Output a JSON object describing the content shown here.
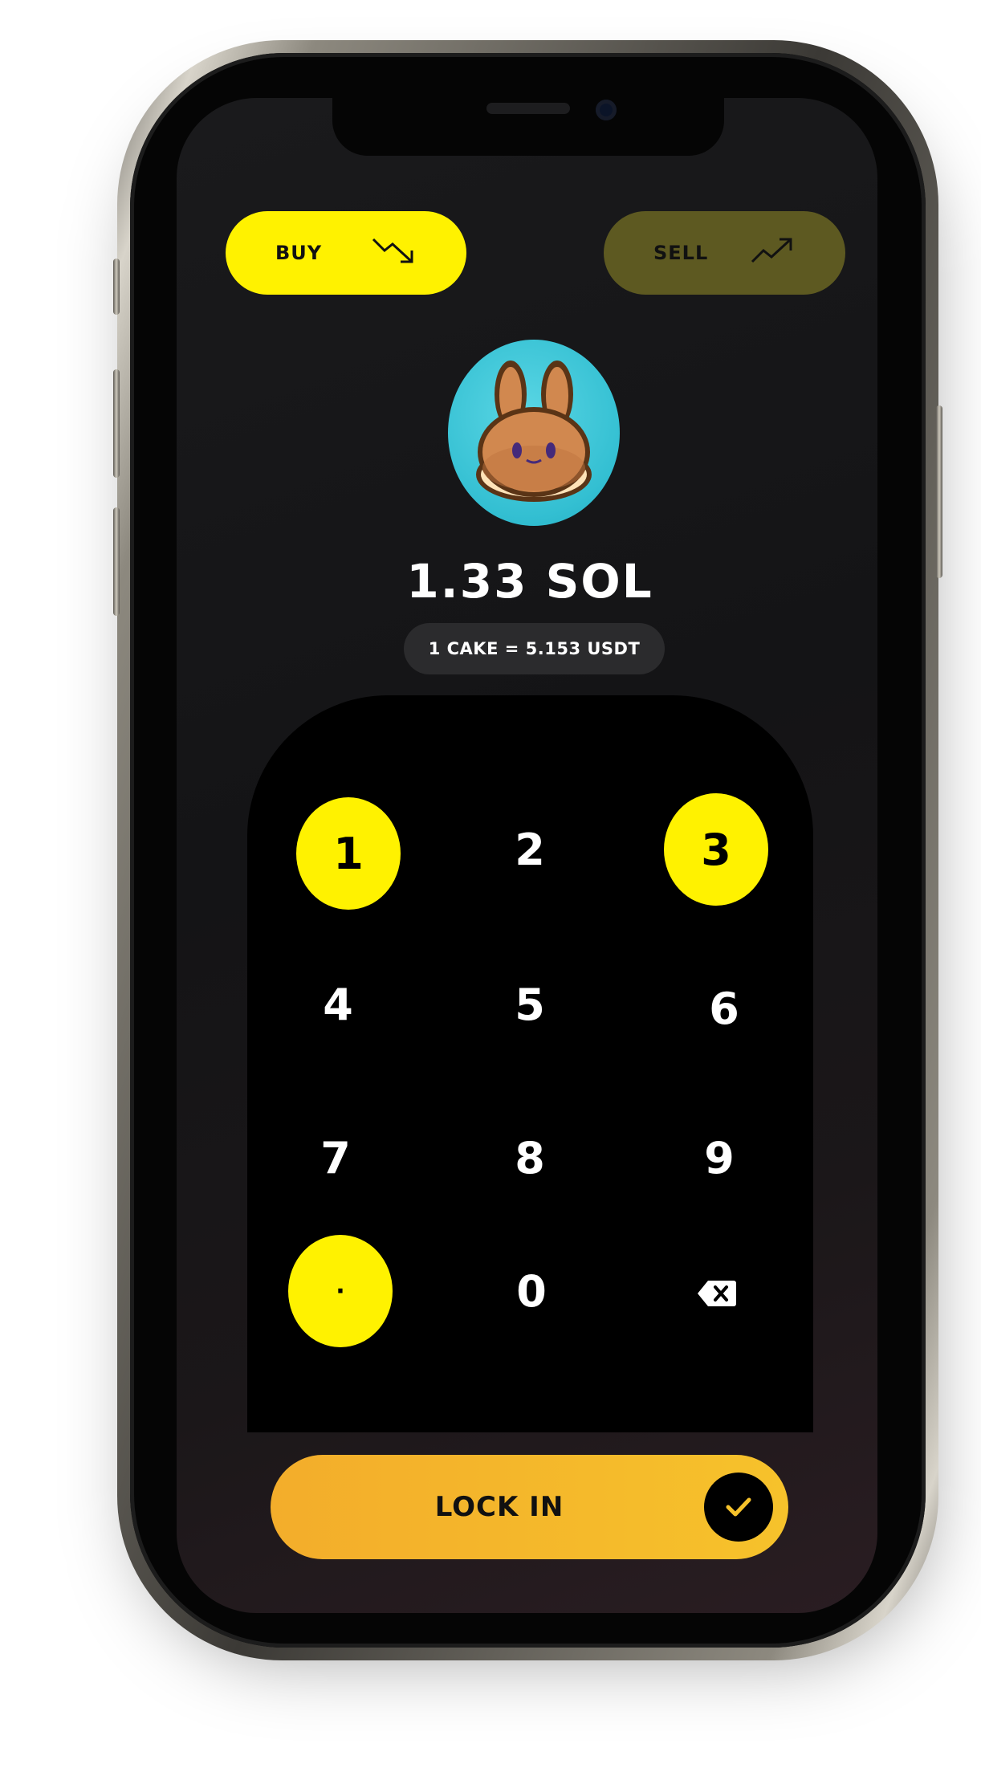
{
  "header": {
    "buy_label": "BUY",
    "sell_label": "SELL"
  },
  "token": {
    "icon": "pancake-bunny-icon"
  },
  "amount": "1.33 SOL",
  "rate": "1 CAKE = 5.153 USDT",
  "keypad": {
    "keys": [
      "1",
      "2",
      "3",
      "4",
      "5",
      "6",
      "7",
      "8",
      "9",
      "·",
      "0"
    ],
    "backspace_icon": "backspace-icon"
  },
  "action": {
    "label": "LOCK IN",
    "icon": "check-icon"
  },
  "colors": {
    "accent": "#fff200",
    "sell_bg": "#5d5921",
    "lock_gradient_start": "#f3ad2b",
    "lock_gradient_end": "#f6c22b",
    "token_bg": "#33bfd2"
  }
}
